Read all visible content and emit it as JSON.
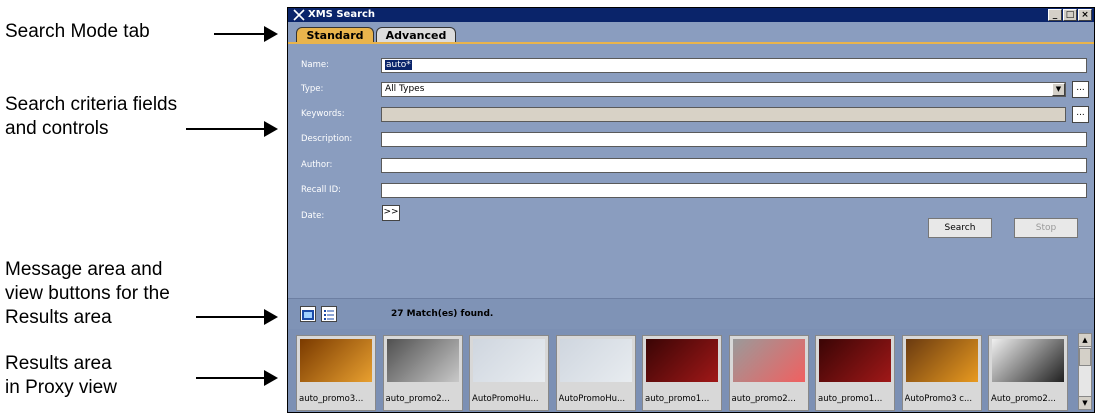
{
  "annotations": {
    "search_mode": "Search Mode tab",
    "criteria_line1": "Search criteria fields",
    "criteria_line2": "and controls",
    "message_line1": "Message area and",
    "message_line2": "view buttons for the",
    "message_line3": "Results area",
    "results_line1": "Results area",
    "results_line2": "in Proxy view"
  },
  "window": {
    "title": "XMS Search",
    "btn_min": "_",
    "btn_max": "□",
    "btn_close": "×"
  },
  "tabs": {
    "standard": "Standard",
    "advanced": "Advanced"
  },
  "form": {
    "name_label": "Name:",
    "name_value": "auto*",
    "type_label": "Type:",
    "type_value": "All Types",
    "keywords_label": "Keywords:",
    "keywords_value": "",
    "description_label": "Description:",
    "description_value": "",
    "author_label": "Author:",
    "author_value": "",
    "recall_label": "Recall ID:",
    "recall_value": "",
    "date_label": "Date:",
    "date_button": ">>",
    "browse_button": "...",
    "dropdown_arrow": "▼"
  },
  "actions": {
    "search": "Search",
    "stop": "Stop"
  },
  "message": {
    "text": "27 Match(es) found."
  },
  "scrollbar": {
    "up": "▲",
    "down": "▼"
  },
  "results": [
    {
      "caption": "auto_promo3...",
      "colors": [
        "#7a3a00",
        "#e8a030"
      ]
    },
    {
      "caption": "auto_promo2...",
      "colors": [
        "#505050",
        "#c8c8c8"
      ]
    },
    {
      "caption": "AutoPromoHu...",
      "colors": [
        "#cfd6df",
        "#e8ecf0"
      ]
    },
    {
      "caption": "AutoPromoHu...",
      "colors": [
        "#cfd6df",
        "#e8ecf0"
      ]
    },
    {
      "caption": "auto_promo1...",
      "colors": [
        "#3a0505",
        "#a01818"
      ]
    },
    {
      "caption": "auto_promo2...",
      "colors": [
        "#9a9a9a",
        "#f06060"
      ]
    },
    {
      "caption": "auto_promo1...",
      "colors": [
        "#3a0505",
        "#a01818"
      ]
    },
    {
      "caption": "AutoPromo3 c...",
      "colors": [
        "#6a3a10",
        "#e89a20"
      ]
    },
    {
      "caption": "Auto_promo2...",
      "colors": [
        "#f0f0f0",
        "#202020"
      ]
    }
  ]
}
